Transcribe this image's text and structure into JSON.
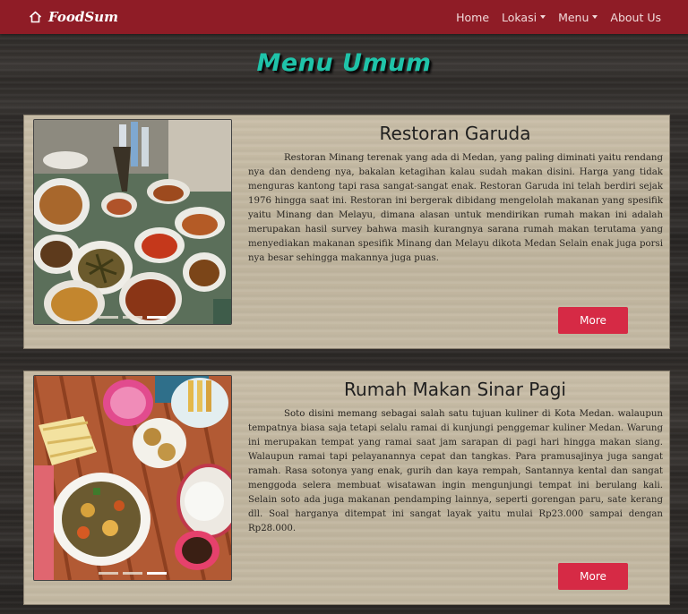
{
  "navbar": {
    "brand": "FoodSum",
    "brand_icon": "home-icon",
    "items": [
      {
        "label": "Home",
        "dropdown": false
      },
      {
        "label": "Lokasi",
        "dropdown": true
      },
      {
        "label": "Menu",
        "dropdown": true
      },
      {
        "label": "About Us",
        "dropdown": false
      }
    ]
  },
  "page": {
    "title": "Menu Umum"
  },
  "cards": [
    {
      "title": "Restoran Garuda",
      "text": "Restoran Minang terenak yang ada di Medan, yang paling diminati yaitu rendang nya dan dendeng nya, bakalan ketagihan kalau sudah makan disini. Harga yang tidak menguras kantong tapi rasa sangat-sangat enak. Restoran Garuda ini telah berdiri sejak 1976 hingga saat ini. Restoran ini bergerak dibidang mengelolah makanan yang spesifik yaitu Minang dan Melayu, dimana alasan untuk mendirikan rumah makan ini adalah merupakan hasil survey bahwa masih kurangnya sarana rumah makan terutama yang menyediakan makanan spesifik Minang dan Melayu dikota Medan Selain enak juga porsi nya besar sehingga makannya juga puas.",
      "button": "More"
    },
    {
      "title": "Rumah Makan Sinar Pagi",
      "text": "Soto disini memang sebagai salah satu tujuan kuliner di Kota Medan. walaupun tempatnya biasa saja tetapi selalu ramai di kunjungi penggemar kuliner Medan. Warung ini merupakan tempat yang ramai saat jam sarapan di pagi hari hingga makan siang. Walaupun ramai tapi pelayanannya cepat dan tangkas. Para pramusajinya juga sangat ramah. Rasa sotonya yang enak, gurih dan kaya rempah, Santannya kental dan sangat menggoda selera membuat wisatawan ingin mengunjungi tempat ini berulang kali. Selain soto ada juga makanan pendamping lainnya, seperti gorengan paru, sate kerang dll. Soal harganya ditempat ini sangat layak yaitu mulai Rp23.000 sampai dengan Rp28.000.",
      "button": "More"
    }
  ],
  "colors": {
    "navbar": "#8f1c26",
    "title": "#1fc3a9",
    "button": "#d62a45",
    "card": "#c4b9a3"
  }
}
